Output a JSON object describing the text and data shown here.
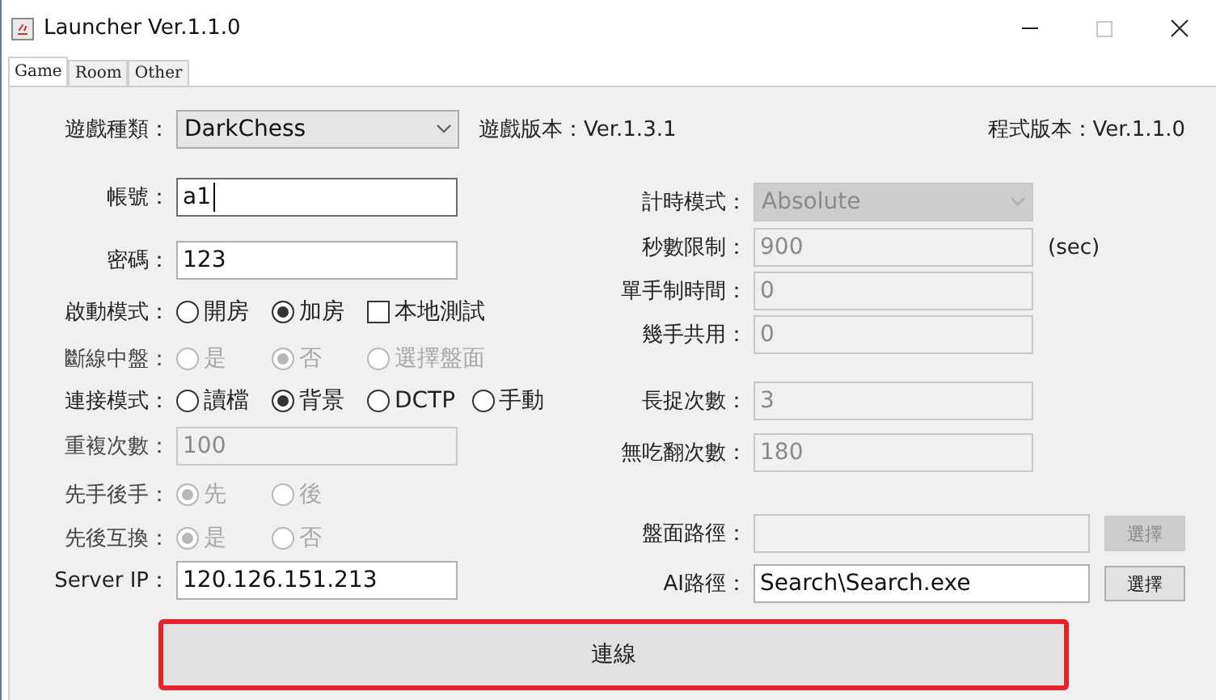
{
  "window": {
    "title": "Launcher Ver.1.1.0"
  },
  "tabs": [
    {
      "label": "Game",
      "selected": true
    },
    {
      "label": "Room",
      "selected": false
    },
    {
      "label": "Other",
      "selected": false
    }
  ],
  "game_type": {
    "label": "遊戲種類：",
    "value": "DarkChess"
  },
  "game_version": "遊戲版本：Ver.1.3.1",
  "program_version": "程式版本：Ver.1.1.0",
  "left_rows": [
    {
      "kind": "field",
      "label": "帳號：",
      "value": "a1",
      "disabled": false,
      "focused": true
    },
    {
      "kind": "field",
      "label": "密碼：",
      "value": "123",
      "disabled": false,
      "focused": false
    },
    {
      "kind": "options",
      "label": "啟動模式：",
      "disabled": false,
      "options": [
        {
          "kind": "radio",
          "label": "開房",
          "selected": false
        },
        {
          "kind": "radio",
          "label": "加房",
          "selected": true
        },
        {
          "kind": "checkbox",
          "label": "本地測試",
          "checked": false
        }
      ]
    },
    {
      "kind": "options",
      "label": "斷線中盤：",
      "disabled": true,
      "options": [
        {
          "kind": "radio",
          "label": "是",
          "selected": false
        },
        {
          "kind": "radio",
          "label": "否",
          "selected": true
        },
        {
          "kind": "radio",
          "label": "選擇盤面",
          "selected": false
        }
      ]
    },
    {
      "kind": "options",
      "label": "連接模式：",
      "disabled": false,
      "options": [
        {
          "kind": "radio",
          "label": "讀檔",
          "selected": false
        },
        {
          "kind": "radio",
          "label": "背景",
          "selected": true
        },
        {
          "kind": "radio",
          "label": "DCTP",
          "selected": false
        },
        {
          "kind": "radio",
          "label": "手動",
          "selected": false
        }
      ]
    },
    {
      "kind": "field",
      "label": "重複次數：",
      "value": "100",
      "disabled": true,
      "focused": false
    },
    {
      "kind": "options",
      "label": "先手後手：",
      "disabled": true,
      "options": [
        {
          "kind": "radio",
          "label": "先",
          "selected": true
        },
        {
          "kind": "radio",
          "label": "後",
          "selected": false
        }
      ]
    },
    {
      "kind": "options",
      "label": "先後互換：",
      "disabled": true,
      "options": [
        {
          "kind": "radio",
          "label": "是",
          "selected": true
        },
        {
          "kind": "radio",
          "label": "否",
          "selected": false
        }
      ]
    },
    {
      "kind": "field",
      "label": "Server IP：",
      "value": "120.126.151.213",
      "disabled": false,
      "focused": false
    }
  ],
  "right_rows": [
    {
      "kind": "combo",
      "label": "計時模式：",
      "value": "Absolute",
      "disabled": true
    },
    {
      "kind": "field",
      "label": "秒數限制：",
      "value": "900",
      "disabled": true,
      "unit": "(sec)"
    },
    {
      "kind": "field",
      "label": "單手制時間：",
      "value": "0",
      "disabled": true
    },
    {
      "kind": "field",
      "label": "幾手共用：",
      "value": "0",
      "disabled": true
    },
    {
      "kind": "field",
      "label": "長捉次數：",
      "value": "3",
      "disabled": true
    },
    {
      "kind": "field",
      "label": "無吃翻次數：",
      "value": "180",
      "disabled": true
    },
    {
      "kind": "path",
      "label": "盤面路徑：",
      "disabled": true,
      "button": "選擇"
    },
    {
      "kind": "path",
      "label": "AI路徑：",
      "value": "Search\\Search.exe",
      "disabled": false,
      "button": "選擇"
    }
  ],
  "connect_button": "連線"
}
